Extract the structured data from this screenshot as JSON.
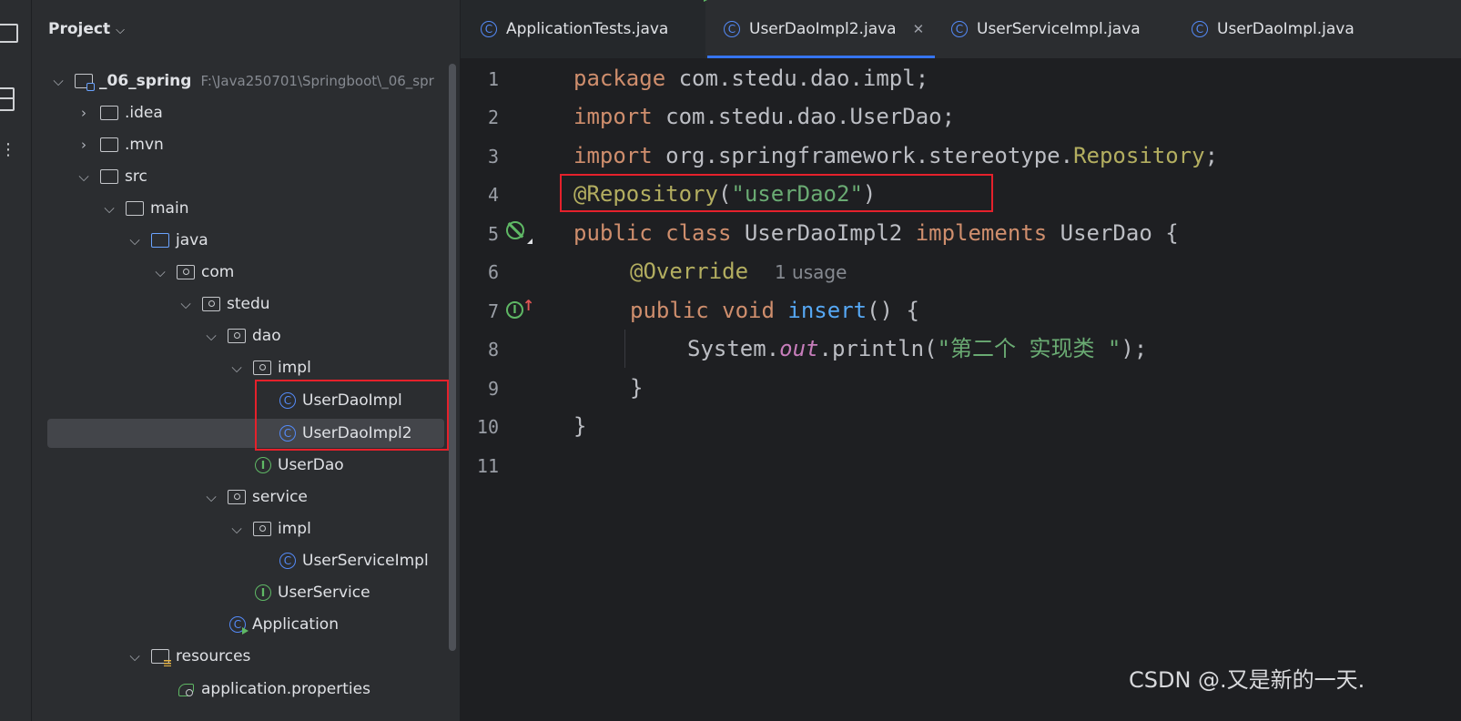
{
  "sidebar": {
    "title": "Project",
    "tree": [
      {
        "label": "_06_spring",
        "path": "F:\\Java250701\\Springboot\\_06_spr",
        "arrow": "⌵",
        "icon": "module"
      },
      {
        "label": ".idea",
        "arrow": "›",
        "icon": "folder"
      },
      {
        "label": ".mvn",
        "arrow": "›",
        "icon": "folder"
      },
      {
        "label": "src",
        "arrow": "⌵",
        "icon": "folder"
      },
      {
        "label": "main",
        "arrow": "⌵",
        "icon": "folder"
      },
      {
        "label": "java",
        "arrow": "⌵",
        "icon": "folder-blue"
      },
      {
        "label": "com",
        "arrow": "⌵",
        "icon": "package"
      },
      {
        "label": "stedu",
        "arrow": "⌵",
        "icon": "package"
      },
      {
        "label": "dao",
        "arrow": "⌵",
        "icon": "package"
      },
      {
        "label": "impl",
        "arrow": "⌵",
        "icon": "package"
      },
      {
        "label": "UserDaoImpl",
        "icon": "class"
      },
      {
        "label": "UserDaoImpl2",
        "icon": "class",
        "selected": true
      },
      {
        "label": "UserDao",
        "icon": "interface"
      },
      {
        "label": "service",
        "arrow": "⌵",
        "icon": "package"
      },
      {
        "label": "impl",
        "arrow": "⌵",
        "icon": "package"
      },
      {
        "label": "UserServiceImpl",
        "icon": "class"
      },
      {
        "label": "UserService",
        "icon": "interface"
      },
      {
        "label": "Application",
        "icon": "spring-app"
      },
      {
        "label": "resources",
        "arrow": "⌵",
        "icon": "resources-folder"
      },
      {
        "label": "application.properties",
        "icon": "properties"
      }
    ]
  },
  "tabs": [
    {
      "label": "ApplicationTests.java",
      "icon": "test-class"
    },
    {
      "label": "UserDaoImpl2.java",
      "icon": "class",
      "active": true,
      "close": "✕"
    },
    {
      "label": "UserServiceImpl.java",
      "icon": "class"
    },
    {
      "label": "UserDaoImpl.java",
      "icon": "class"
    }
  ],
  "icons": {
    "class_glyph": "C",
    "interface_glyph": "I",
    "implements_arrow": "↑"
  },
  "code": {
    "line_numbers": [
      "1",
      "2",
      "3",
      "4",
      "5",
      "6",
      "7",
      "8",
      "9",
      "10",
      "11"
    ],
    "l1": {
      "kw": "package",
      "rest": " com.stedu.dao.impl;"
    },
    "l2": {
      "kw": "import",
      "rest": " com.stedu.dao.UserDao;"
    },
    "l3": {
      "kw": "import",
      "rest": " org.springframework.stereotype.",
      "ann": "Repository",
      "end": ";"
    },
    "l4": {
      "ann": "@Repository",
      "open": "(",
      "str": "\"userDao2\"",
      "close": ")"
    },
    "l5": {
      "kw1": "public class",
      "name": " UserDaoImpl2 ",
      "kw2": "implements",
      "rest": " UserDao {"
    },
    "l6": {
      "ann": "@Override",
      "hint": "1 usage"
    },
    "l7": {
      "kw": "public void",
      "fn": "insert",
      "rest": "() {"
    },
    "l8": {
      "pre": "System.",
      "fld": "out",
      "mid": ".println(",
      "str": "\"第二个 实现类 \"",
      "end": ");"
    },
    "l9": "}",
    "l10": "}"
  },
  "watermark": "CSDN @.又是新的一天."
}
